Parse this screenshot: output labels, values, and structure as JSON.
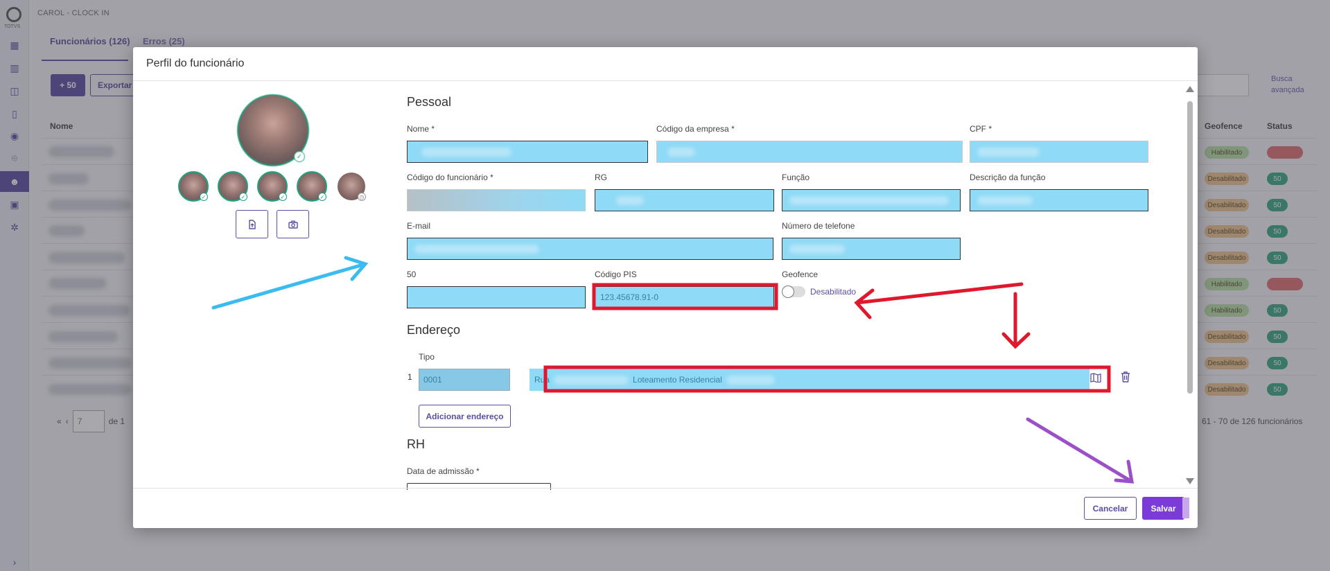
{
  "app": {
    "logo_text": "TOTVS",
    "title": "CAROL - CLOCK IN",
    "tabs": [
      "Funcionários (126)",
      "Erros (25)"
    ],
    "add_label": "+ 50",
    "export_label": "Exportar",
    "advanced_search": "Busca avançada",
    "columns": {
      "name": "Nome",
      "geofence": "Geofence",
      "status": "Status"
    },
    "geofence_values": [
      "Habilitado",
      "Desabilitado"
    ],
    "status_value": "50",
    "page_current": "7",
    "page_of": "de 1",
    "page_info": "61 - 70 de 126 funcionários"
  },
  "modal": {
    "title": "Perfil do funcionário",
    "sections": {
      "personal": "Pessoal",
      "address": "Endereço",
      "hr": "RH"
    },
    "labels": {
      "name": "Nome *",
      "company_code": "Código da empresa *",
      "cpf": "CPF *",
      "employee_code": "Código do funcionário *",
      "rg": "RG",
      "role": "Função",
      "role_desc": "Descrição da função",
      "email": "E-mail",
      "phone": "Número de telefone",
      "field_50": "50",
      "pis": "Código PIS",
      "geofence": "Geofence",
      "tipo": "Tipo",
      "admission": "Data de admissão *"
    },
    "values": {
      "pis": "123.45678.91-0",
      "geofence_state": "Desabilitado",
      "address_index": "1",
      "address_type": "0001",
      "address_street_prefix": "Rua",
      "address_neighborhood": "Loteamento Residencial"
    },
    "add_address_label": "Adicionar endereço",
    "cancel_label": "Cancelar",
    "save_label": "Salvar"
  },
  "colors": {
    "accent": "#5b4ea0",
    "save": "#7a3bd6",
    "field_highlight": "#8fdaf6",
    "annotation_red": "#e0182d",
    "annotation_blue": "#3bbcf0",
    "annotation_purple": "#9b4fc8",
    "photo_ring": "#1fa37f"
  }
}
